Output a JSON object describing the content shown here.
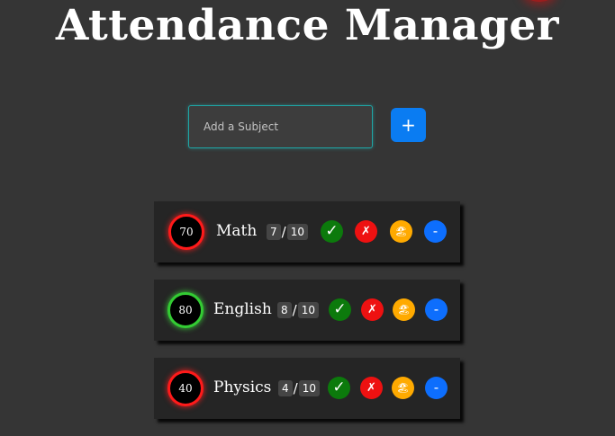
{
  "header": {
    "title": "Attendance Manager"
  },
  "add_subject": {
    "placeholder": "Add a Subject",
    "button_label": "+"
  },
  "subjects": [
    {
      "name": "Math",
      "percent": "70",
      "attended": "7",
      "total": "10",
      "ring_color": "#ff1a1a"
    },
    {
      "name": "English",
      "percent": "80",
      "attended": "8",
      "total": "10",
      "ring_color": "#33cc33"
    },
    {
      "name": "Physics",
      "percent": "40",
      "attended": "4",
      "total": "10",
      "ring_color": "#ff1a1a"
    }
  ],
  "actions": {
    "present": "✓",
    "absent": "✗",
    "leave": "🏖",
    "remove": "-"
  },
  "colors": {
    "background": "#353535",
    "card": "#252525",
    "accent_blue": "#0a7cf2",
    "present_green": "#0c7a0c",
    "absent_red": "#ee1111",
    "leave_orange": "#ffaa00",
    "input_border": "#1ea5a5"
  }
}
